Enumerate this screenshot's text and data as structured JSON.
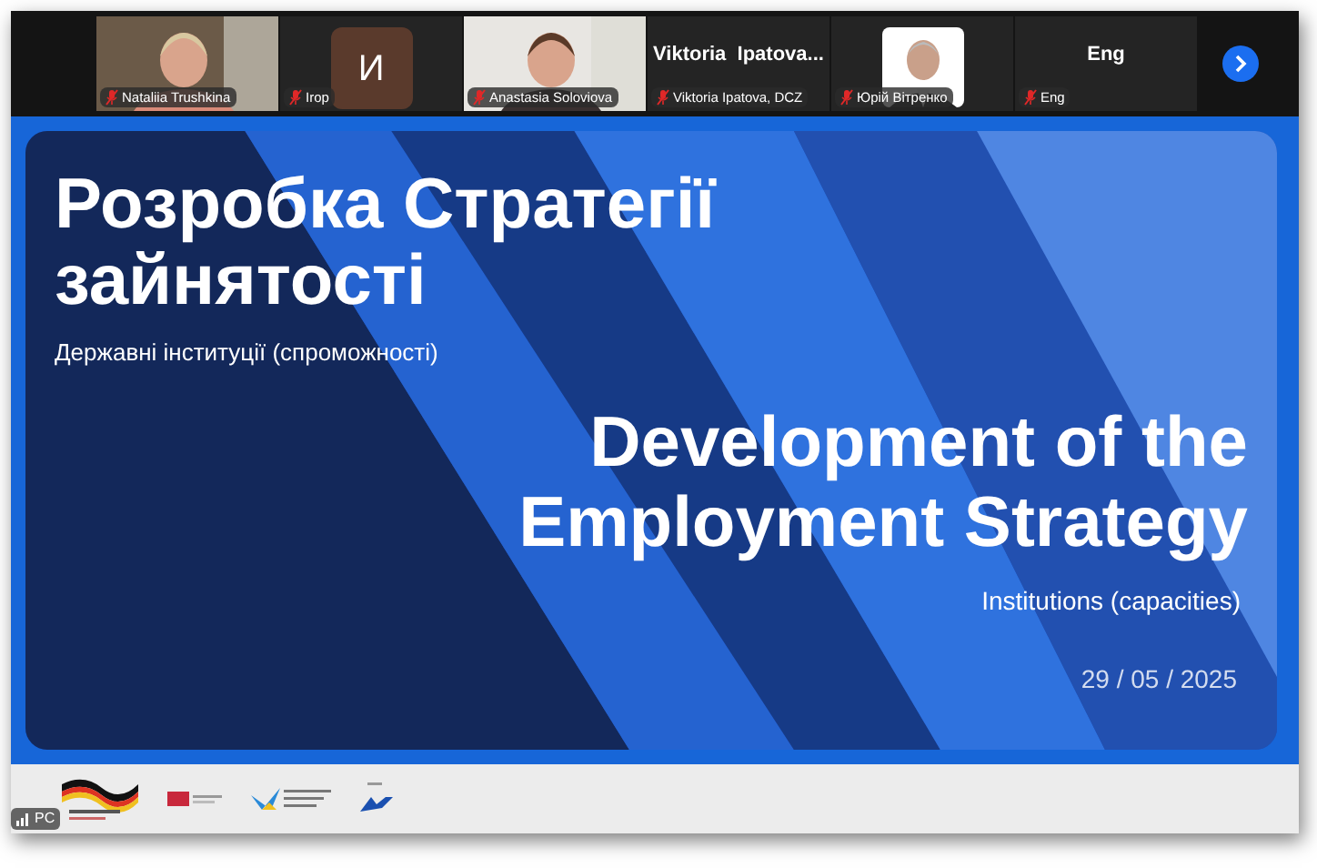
{
  "participants": [
    {
      "kind": "video",
      "name": "Nataliia Trushkina",
      "muted": true
    },
    {
      "kind": "avatar",
      "initial": "И",
      "name": "Irop",
      "muted": true
    },
    {
      "kind": "video",
      "name": "Anastasia Soloviova",
      "muted": true
    },
    {
      "kind": "name",
      "display_name": "Viktoria  Ipatova...",
      "name": "Viktoria Ipatova, DCZ",
      "muted": true
    },
    {
      "name": "Юрій Вітренко",
      "muted": true
    },
    {
      "kind": "name",
      "display_name": "Eng",
      "name": "Eng",
      "muted": true
    }
  ],
  "slide": {
    "title_uk": "Розробка Стратегії зайнятості",
    "subtitle_uk": "Державні інституції (спроможності)",
    "title_en": "Development of the Employment Strategy",
    "subtitle_en": "Institutions (capacities)",
    "date": "29 / 05 / 2025"
  },
  "connection_badge": "PC"
}
